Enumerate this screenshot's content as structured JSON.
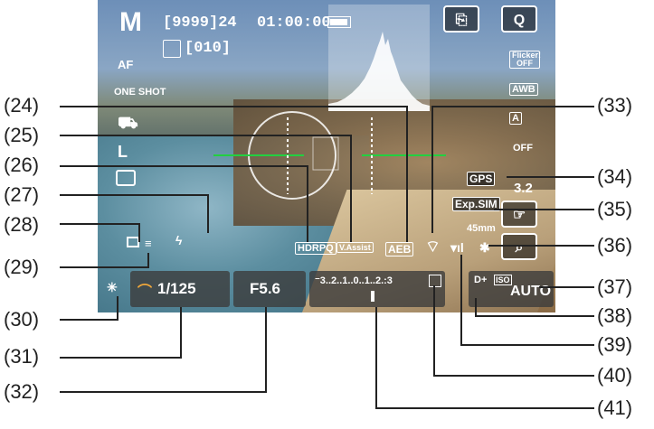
{
  "screen": {
    "mode": "M",
    "shots_remaining": "[9999]24",
    "movie_time": "01:00:00",
    "battery": "battery-icon",
    "focus_bracket_count": "[010]",
    "af_method": "AF",
    "af_operation": "ONE SHOT",
    "image_quality": "L",
    "aeb": "AEB",
    "hdr_pq": "HDRPQ",
    "v_assist": "V.Assist",
    "gps": "GPS",
    "exp_sim": "Exp.SIM",
    "focal_length": "45mm",
    "iso_label": "ISO",
    "iso_value": "AUTO",
    "d_plus": "D+",
    "shutter_speed": "1/125",
    "aperture": "F5.6",
    "exposure_scale": "⁻3..2..1..0..1..2.:3",
    "right_panel": {
      "q_button": "Q",
      "flicker": "Flicker!\nOFF",
      "wb": "AWB",
      "picture_style": "A",
      "lens_correction": "OFF",
      "value_3_2": "3.2"
    }
  },
  "callouts_left": [
    "(24)",
    "(25)",
    "(26)",
    "(27)",
    "(28)",
    "(29)",
    "(30)",
    "(31)",
    "(32)"
  ],
  "callouts_right": [
    "(33)",
    "(34)",
    "(35)",
    "(36)",
    "(37)",
    "(38)",
    "(39)",
    "(40)",
    "(41)"
  ]
}
